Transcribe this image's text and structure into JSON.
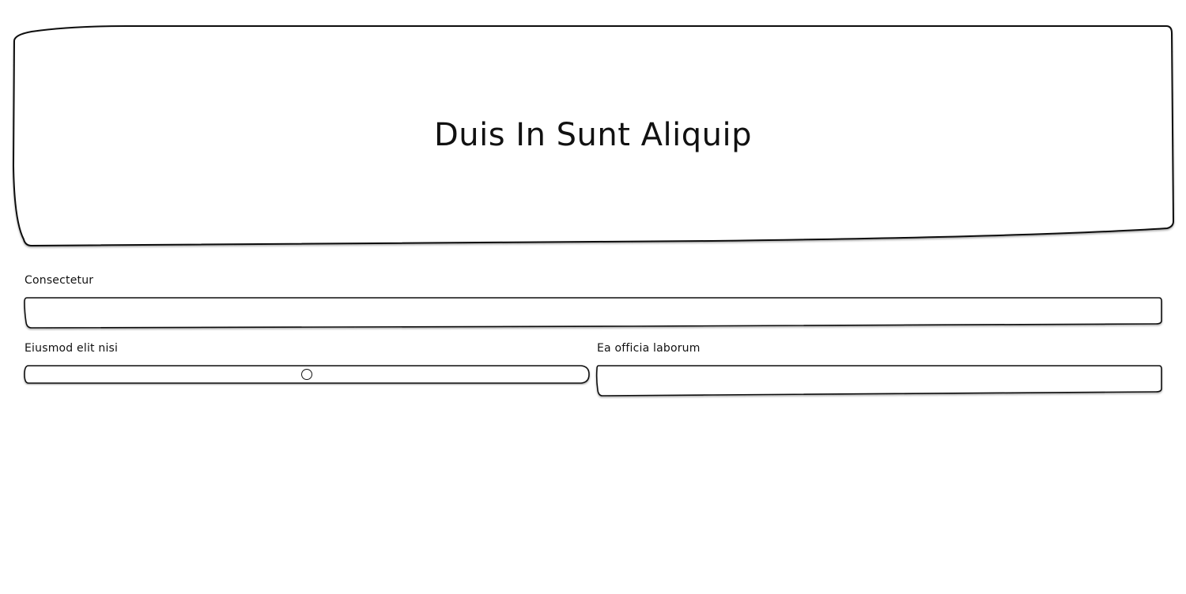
{
  "banner": {
    "title": "Duis In Sunt Aliquip"
  },
  "form": {
    "field_1": {
      "label": "Consectetur",
      "value": ""
    },
    "slider": {
      "label": "Eiusmod elit nisi",
      "value_fraction": 0.5
    },
    "field_2": {
      "label": "Ea officia laborum",
      "value": ""
    }
  }
}
